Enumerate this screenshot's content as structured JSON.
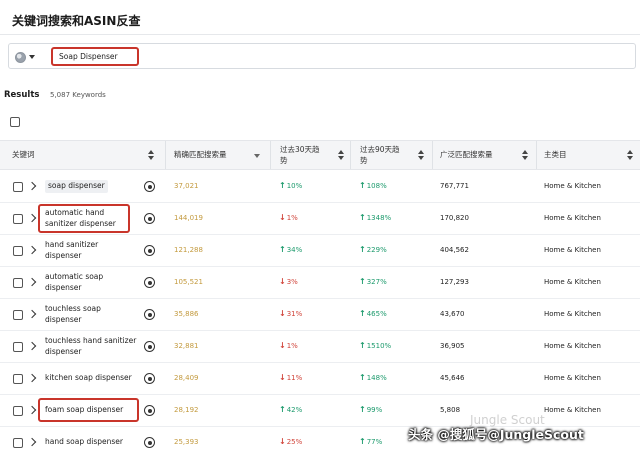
{
  "page": {
    "title": "关键词搜索和ASIN反查"
  },
  "search": {
    "value": "Soap Dispenser",
    "flag_icon": "us-flag-icon"
  },
  "results": {
    "label": "Results",
    "count": "5,087 Keywords"
  },
  "columns": {
    "keyword": "关键词",
    "exact_volume": "精确匹配搜索量",
    "trend30": "过去30天趋势",
    "trend90": "过去90天趋势",
    "broad_volume": "广泛匹配搜索量",
    "category": "主类目"
  },
  "colors": {
    "highlight": "#c9352b",
    "up": "#1c9a6c",
    "down": "#d1453b",
    "exact": "#c39a3e"
  },
  "rows": [
    {
      "keyword": "soap dispenser",
      "exact": "37,021",
      "t30": "10%",
      "t30_dir": "up",
      "t90": "108%",
      "t90_dir": "up",
      "broad": "767,771",
      "category": "Home & Kitchen"
    },
    {
      "keyword": "automatic hand sanitizer dispenser",
      "exact": "144,019",
      "t30": "1%",
      "t30_dir": "down",
      "t90": "1348%",
      "t90_dir": "up",
      "broad": "170,820",
      "category": "Home & Kitchen"
    },
    {
      "keyword": "hand sanitizer dispenser",
      "exact": "121,288",
      "t30": "34%",
      "t30_dir": "up",
      "t90": "229%",
      "t90_dir": "up",
      "broad": "404,562",
      "category": "Home & Kitchen"
    },
    {
      "keyword": "automatic soap dispenser",
      "exact": "105,521",
      "t30": "3%",
      "t30_dir": "down",
      "t90": "327%",
      "t90_dir": "up",
      "broad": "127,293",
      "category": "Home & Kitchen"
    },
    {
      "keyword": "touchless soap dispenser",
      "exact": "35,886",
      "t30": "31%",
      "t30_dir": "down",
      "t90": "465%",
      "t90_dir": "up",
      "broad": "43,670",
      "category": "Home & Kitchen"
    },
    {
      "keyword": "touchless hand sanitizer dispenser",
      "exact": "32,881",
      "t30": "1%",
      "t30_dir": "down",
      "t90": "1510%",
      "t90_dir": "up",
      "broad": "36,905",
      "category": "Home & Kitchen"
    },
    {
      "keyword": "kitchen soap dispenser",
      "exact": "28,409",
      "t30": "11%",
      "t30_dir": "down",
      "t90": "148%",
      "t90_dir": "up",
      "broad": "45,646",
      "category": "Home & Kitchen"
    },
    {
      "keyword": "foam soap dispenser",
      "exact": "28,192",
      "t30": "42%",
      "t30_dir": "up",
      "t90": "99%",
      "t90_dir": "up",
      "broad": "5,808",
      "category": "Home & Kitchen"
    },
    {
      "keyword": "hand soap dispenser",
      "exact": "25,393",
      "t30": "25%",
      "t30_dir": "down",
      "t90": "77%",
      "t90_dir": "up",
      "broad": "",
      "category": ""
    }
  ],
  "watermark": {
    "brand": "Jungle Scout",
    "caption": "头条 @搜狐号@JungleScout"
  }
}
